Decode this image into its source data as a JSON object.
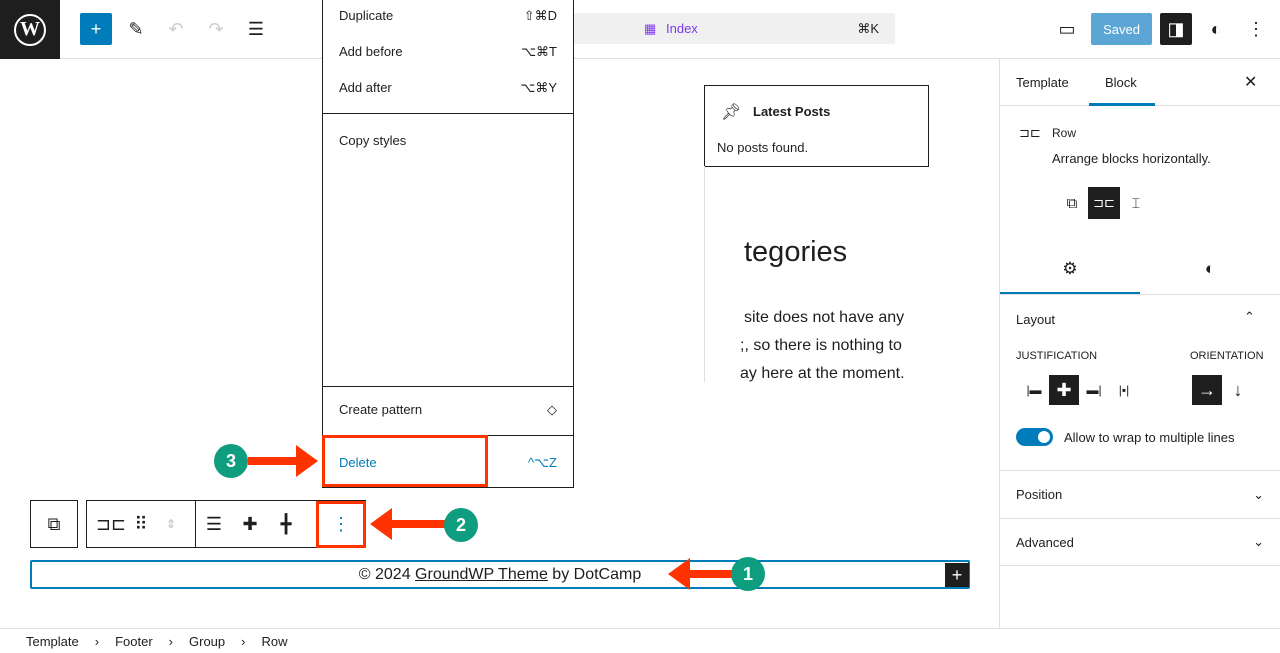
{
  "topbar": {
    "command_label": "Index",
    "command_shortcut": "⌘K",
    "saved_label": "Saved"
  },
  "menu": {
    "items": [
      {
        "label": "Duplicate",
        "shortcut": "⇧⌘D"
      },
      {
        "label": "Add before",
        "shortcut": "⌥⌘T"
      },
      {
        "label": "Add after",
        "shortcut": "⌥⌘Y"
      },
      {
        "label": "Copy styles",
        "shortcut": ""
      },
      {
        "label": "Create pattern",
        "shortcut": ""
      },
      {
        "label": "Delete",
        "shortcut": "^⌥Z"
      }
    ]
  },
  "canvas": {
    "latest_posts_title": "Latest Posts",
    "no_posts": "No posts found.",
    "categories_heading": "tegories",
    "categories_text": [
      "site does not have any",
      ";, so there is nothing to",
      "ay here at the moment."
    ],
    "footer_prefix": "© 2024 ",
    "footer_link": "GroundWP Theme",
    "footer_suffix": " by DotCamp"
  },
  "annotations": [
    "1",
    "2",
    "3"
  ],
  "sidebar": {
    "tabs": [
      "Template",
      "Block"
    ],
    "active_tab": "Block",
    "block_name": "Row",
    "block_desc": "Arrange blocks horizontally.",
    "layout_title": "Layout",
    "justification_label": "JUSTIFICATION",
    "orientation_label": "ORIENTATION",
    "wrap_label": "Allow to wrap to multiple lines",
    "wrap_on": true,
    "sections": [
      "Position",
      "Advanced"
    ]
  },
  "breadcrumb": [
    "Template",
    "Footer",
    "Group",
    "Row"
  ],
  "colors": {
    "accent": "#007cba",
    "annotation": "#ff3300",
    "badge": "#0f9d7f"
  }
}
